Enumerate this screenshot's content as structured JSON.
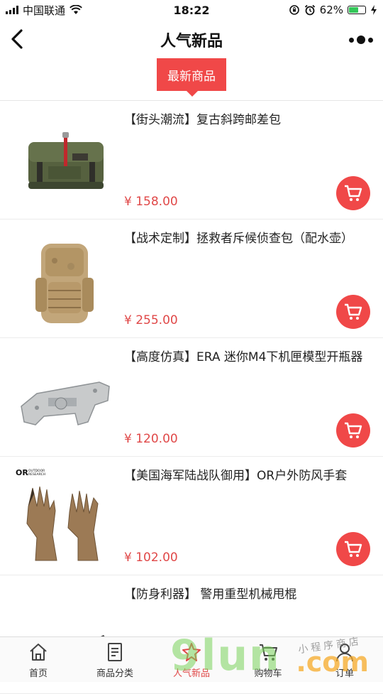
{
  "status_bar": {
    "carrier": "中国联通",
    "time": "18:22",
    "battery": "62%",
    "battery_level": 0.62
  },
  "nav": {
    "title": "人气新品"
  },
  "tab_badge": {
    "label": "最新商品"
  },
  "products": [
    {
      "name": "【街头潮流】复古斜跨邮差包",
      "price": "¥ 158.00",
      "image": "messenger-bag"
    },
    {
      "name": "【战术定制】拯救者斥候侦查包（配水壶）",
      "price": "¥ 255.00",
      "image": "tactical-backpack"
    },
    {
      "name": "【高度仿真】ERA 迷你M4下机匣模型开瓶器",
      "price": "¥ 120.00",
      "image": "m4-lower-receiver"
    },
    {
      "name": "【美国海军陆战队御用】OR户外防风手套",
      "price": "¥ 102.00",
      "image": "outdoor-gloves",
      "brand_lines": [
        "OR",
        "OUTDOOR",
        "RESEARCH"
      ]
    },
    {
      "name": "【防身利器】 警用重型机械甩棍",
      "price": "",
      "image": "baton"
    }
  ],
  "bottom_tabs": [
    {
      "label": "首页",
      "icon": "home-icon"
    },
    {
      "label": "商品分类",
      "icon": "category-icon"
    },
    {
      "label": "人气新品",
      "icon": "new-icon",
      "active": true
    },
    {
      "label": "购物车",
      "icon": "cart-icon"
    },
    {
      "label": "订单",
      "icon": "user-icon"
    }
  ],
  "watermark": {
    "brand": "9lun",
    "domain": ".com",
    "tagline": "小程序商店"
  }
}
